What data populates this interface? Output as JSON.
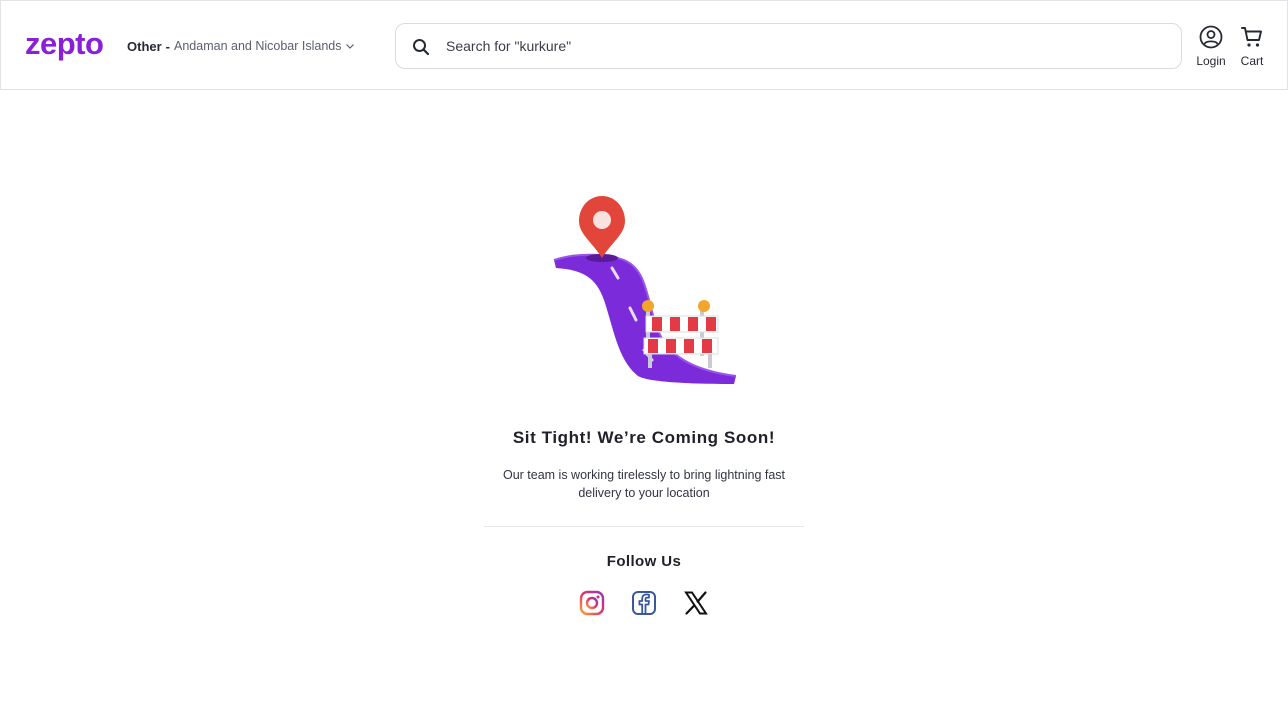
{
  "header": {
    "logo_text": "zepto",
    "location_label": "Other",
    "location_separator": "-",
    "location_value": "Andaman and Nicobar Islands",
    "search_placeholder": "Search for \"kurkure\"",
    "login_label": "Login",
    "cart_label": "Cart"
  },
  "main": {
    "title": "Sit Tight! We’re Coming Soon!",
    "subtitle": "Our team is working tirelessly to bring lightning fast delivery to your location",
    "follow_label": "Follow Us"
  },
  "social": [
    {
      "name": "instagram-icon"
    },
    {
      "name": "facebook-icon"
    },
    {
      "name": "x-icon"
    }
  ],
  "colors": {
    "brand": "#8a1fd9",
    "road": "#7b2bd9",
    "pin": "#e2463a",
    "barrier_red": "#e23b45"
  }
}
